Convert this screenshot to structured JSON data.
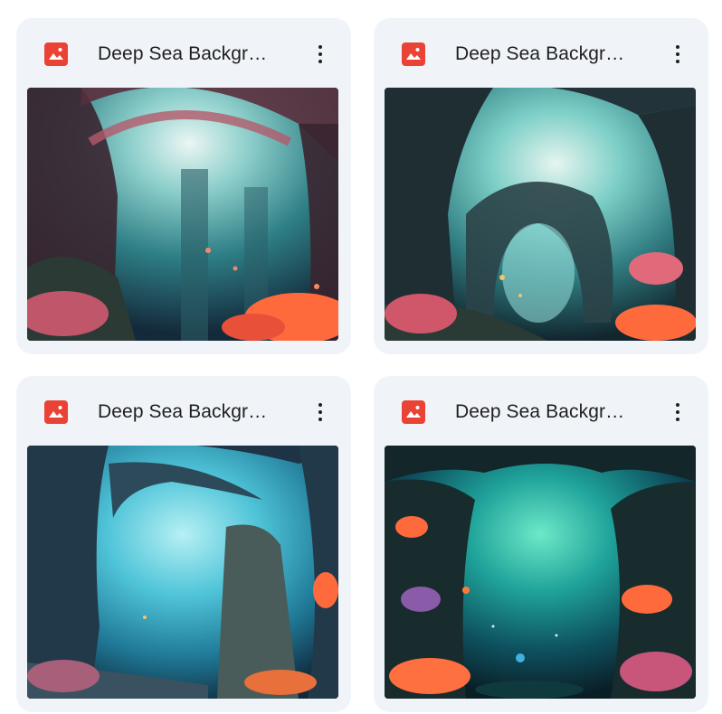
{
  "files": [
    {
      "title": "Deep Sea Backgr…",
      "icon": "image-icon",
      "icon_color": "#ea4335",
      "thumbnail": "underwater-coral-arch-pink"
    },
    {
      "title": "Deep Sea Backgr…",
      "icon": "image-icon",
      "icon_color": "#ea4335",
      "thumbnail": "underwater-rock-arch-cave"
    },
    {
      "title": "Deep Sea Backgr…",
      "icon": "image-icon",
      "icon_color": "#ea4335",
      "thumbnail": "underwater-stone-arch-blue"
    },
    {
      "title": "Deep Sea Backgr…",
      "icon": "image-icon",
      "icon_color": "#ea4335",
      "thumbnail": "underwater-cave-green"
    }
  ]
}
